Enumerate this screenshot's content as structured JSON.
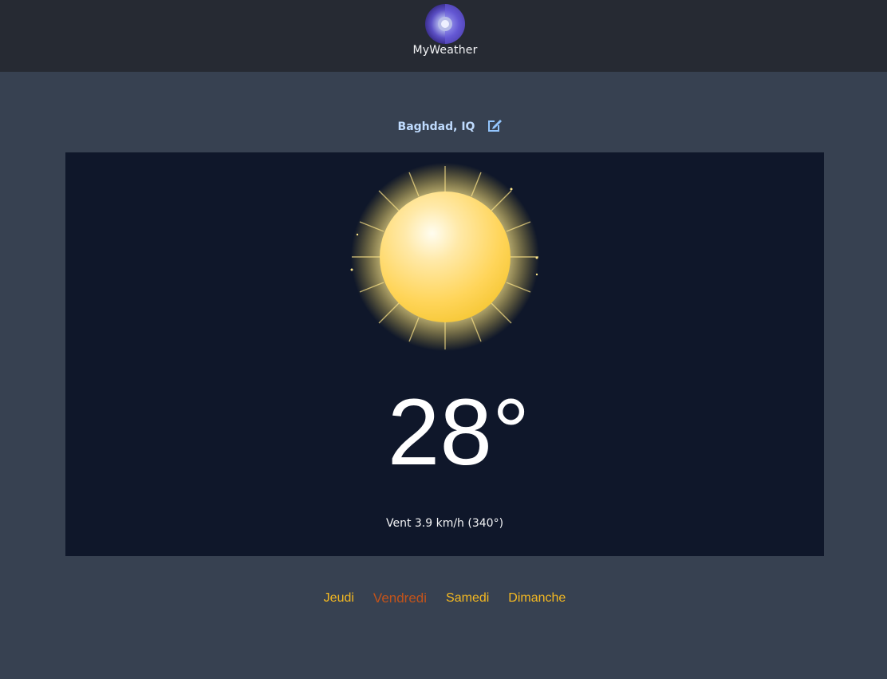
{
  "header": {
    "brand": "MyWeather",
    "logo_icon": "moon-logo-icon"
  },
  "location": {
    "name": "Baghdad, IQ",
    "edit_icon": "edit-icon"
  },
  "current": {
    "icon": "sun-icon",
    "temperature": "28°",
    "wind": "Vent 3.9 km/h (340°)"
  },
  "days": [
    {
      "label": "Jeudi",
      "active": false
    },
    {
      "label": "Vendredi",
      "active": true
    },
    {
      "label": "Samedi",
      "active": false
    },
    {
      "label": "Dimanche",
      "active": false
    }
  ],
  "colors": {
    "background": "#374151",
    "topbar": "#262a33",
    "card": "#0f172a",
    "location_text": "#bfdbfe",
    "day_text": "#f5b921",
    "day_active": "#c2531a"
  }
}
